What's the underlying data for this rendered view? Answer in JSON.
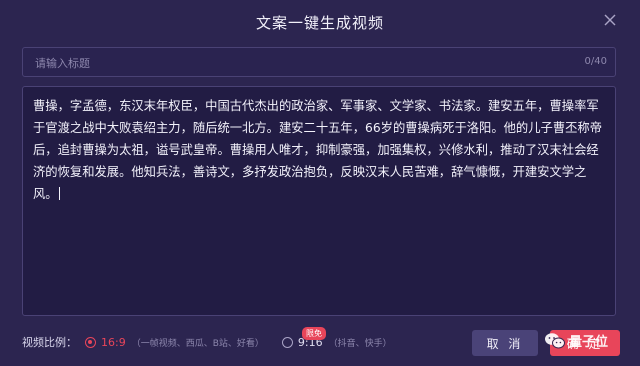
{
  "dialog": {
    "title": "文案一键生成视频",
    "close_icon": "close-icon"
  },
  "title_input": {
    "placeholder": "请输入标题",
    "value": "",
    "counter": "0/40"
  },
  "content": {
    "text": "曹操，字孟德，东汉末年权臣，中国古代杰出的政治家、军事家、文学家、书法家。建安五年，曹操率军于官渡之战中大败袁绍主力，随后统一北方。建安二十五年，66岁的曹操病死于洛阳。他的儿子曹丕称帝后，追封曹操为太祖，谥号武皇帝。曹操用人唯才，抑制豪强，加强集权，兴修水利，推动了汉末社会经济的恢复和发展。他知兵法，善诗文，多抒发政治抱负，反映汉末人民苦难，辞气慷慨，开建安文学之风。"
  },
  "ratio": {
    "label": "视频比例：",
    "options": [
      {
        "value": "16:9",
        "desc": "（一帧视频、西瓜、B站、好看）",
        "selected": true
      },
      {
        "value": "9:16",
        "desc": "（抖音、快手）",
        "selected": false,
        "badge": "限免"
      }
    ]
  },
  "buttons": {
    "cancel": "取 消",
    "confirm": "确 定"
  },
  "watermark": {
    "text": "量子位"
  },
  "colors": {
    "accent": "#e8455a",
    "background": "#2c2550"
  }
}
